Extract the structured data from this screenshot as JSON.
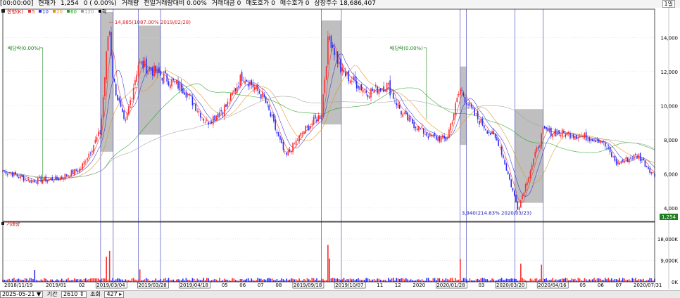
{
  "header": {
    "time": "[00:00:00]",
    "price_label": "현재가",
    "price_value": "1,254",
    "change_text": "0 ( 0.00%)",
    "volume_label": "거래량",
    "volume_ratio_text": "전일거래량대비 0.00%",
    "trade_amount_text": "거래대금 0",
    "ask_text": "매도호가 0",
    "bid_text": "매수호가 0",
    "shares_text": "상장주수 18,686,407",
    "window_button": "1일"
  },
  "legend": {
    "series_label": "한향(K)",
    "ma_items": [
      "5",
      "10",
      "20",
      "60",
      "120",
      "락"
    ],
    "ma_colors": [
      "#e03030",
      "#3030d0",
      "#e09020",
      "#20a020",
      "#a0a0a0",
      "#000000"
    ]
  },
  "volume_panel_label": "거래량",
  "annotations": {
    "high_label": "14,885(1087.00% 2019/02/28)",
    "low_label": "3,940(214.83% 2020/03/23)",
    "ex_div_label": "배당락(0.00%)",
    "current_price_box": "1,254"
  },
  "colors": {
    "up": "#ff2a2a",
    "down": "#2a2aff",
    "highlight": "#b4b4b4"
  },
  "chart_data": {
    "type": "candlestick",
    "price_axis": {
      "ylim": [
        3500,
        15500
      ],
      "ticks": [
        4000,
        6000,
        8000,
        10000,
        12000,
        14000
      ],
      "tick_labels": [
        "4,000",
        "6,000",
        "8,000",
        "10,000",
        "12,000",
        "14,000"
      ]
    },
    "volume_axis": {
      "ylim": [
        0,
        23000
      ],
      "ticks": [
        0,
        9000,
        18000
      ],
      "tick_labels": [
        "0K",
        "9,000K",
        "18,000K"
      ]
    },
    "x_tick_labels": [
      "2018/11/19",
      "2019/01",
      "02",
      "2019/03/04",
      "2019/03/28",
      "2019/04/18",
      "05",
      "06",
      "07",
      "08",
      "2019/09/18",
      "2019/10/07",
      "11",
      "12",
      "2020",
      "2020/01/28",
      "03",
      "2020/03/20",
      "2020/04/16",
      "05",
      "06",
      "07",
      "2020/07/31"
    ],
    "price_path": [
      [
        "2018-11-19",
        6200
      ],
      [
        "2018-12-15",
        5600
      ],
      [
        "2019-01-10",
        5700
      ],
      [
        "2019-02-01",
        6300
      ],
      [
        "2019-02-20",
        8500
      ],
      [
        "2019-02-28",
        14885
      ],
      [
        "2019-03-04",
        11500
      ],
      [
        "2019-03-15",
        8800
      ],
      [
        "2019-03-28",
        12500
      ],
      [
        "2019-04-18",
        11800
      ],
      [
        "2019-05-10",
        11000
      ],
      [
        "2019-06-01",
        9000
      ],
      [
        "2019-06-20",
        10000
      ],
      [
        "2019-07-05",
        11800
      ],
      [
        "2019-07-25",
        10500
      ],
      [
        "2019-08-15",
        7000
      ],
      [
        "2019-09-01",
        8500
      ],
      [
        "2019-09-18",
        9500
      ],
      [
        "2019-09-25",
        14200
      ],
      [
        "2019-10-07",
        12000
      ],
      [
        "2019-11-01",
        10800
      ],
      [
        "2019-11-20",
        11200
      ],
      [
        "2019-12-05",
        9400
      ],
      [
        "2019-12-30",
        8200
      ],
      [
        "2020-01-15",
        8000
      ],
      [
        "2020-01-28",
        11000
      ],
      [
        "2020-02-10",
        9500
      ],
      [
        "2020-03-05",
        7800
      ],
      [
        "2020-03-23",
        3940
      ],
      [
        "2020-04-05",
        6500
      ],
      [
        "2020-04-16",
        8500
      ],
      [
        "2020-05-15",
        8300
      ],
      [
        "2020-06-10",
        8000
      ],
      [
        "2020-06-25",
        6600
      ],
      [
        "2020-07-15",
        7100
      ],
      [
        "2020-07-31",
        5900
      ]
    ],
    "highlight_ranges": [
      [
        "2019-02-20",
        "2019-03-04"
      ],
      [
        "2019-03-28",
        "2019-04-18"
      ],
      [
        "2019-09-18",
        "2019-10-07"
      ],
      [
        "2020-01-28",
        "2020-02-03"
      ],
      [
        "2020-03-20",
        "2020-04-16"
      ]
    ],
    "highlight_price_ranges": [
      [
        7300,
        15500
      ],
      [
        8300,
        14700
      ],
      [
        8900,
        15000
      ],
      [
        7700,
        12300
      ],
      [
        4300,
        9800
      ]
    ],
    "vertical_lines": [
      "2019-02-20",
      "2019-03-04",
      "2019-03-28",
      "2019-04-18",
      "2019-09-18",
      "2019-10-07",
      "2020-01-28",
      "2020-02-03",
      "2020-03-20",
      "2020-04-16"
    ],
    "ex_dividend_dates": [
      "2018-12-27",
      "2019-12-27"
    ],
    "volume_spikes": [
      [
        "2019-02-28",
        15000
      ],
      [
        "2019-03-01",
        13000
      ],
      [
        "2019-02-25",
        10500
      ],
      [
        "2019-09-25",
        15500
      ],
      [
        "2019-09-26",
        9800
      ],
      [
        "2020-01-28",
        9600
      ],
      [
        "2020-04-14",
        7200
      ],
      [
        "2020-03-25",
        7600
      ],
      [
        "2019-03-29",
        5200
      ],
      [
        "2018-12-20",
        5000
      ]
    ]
  }
}
